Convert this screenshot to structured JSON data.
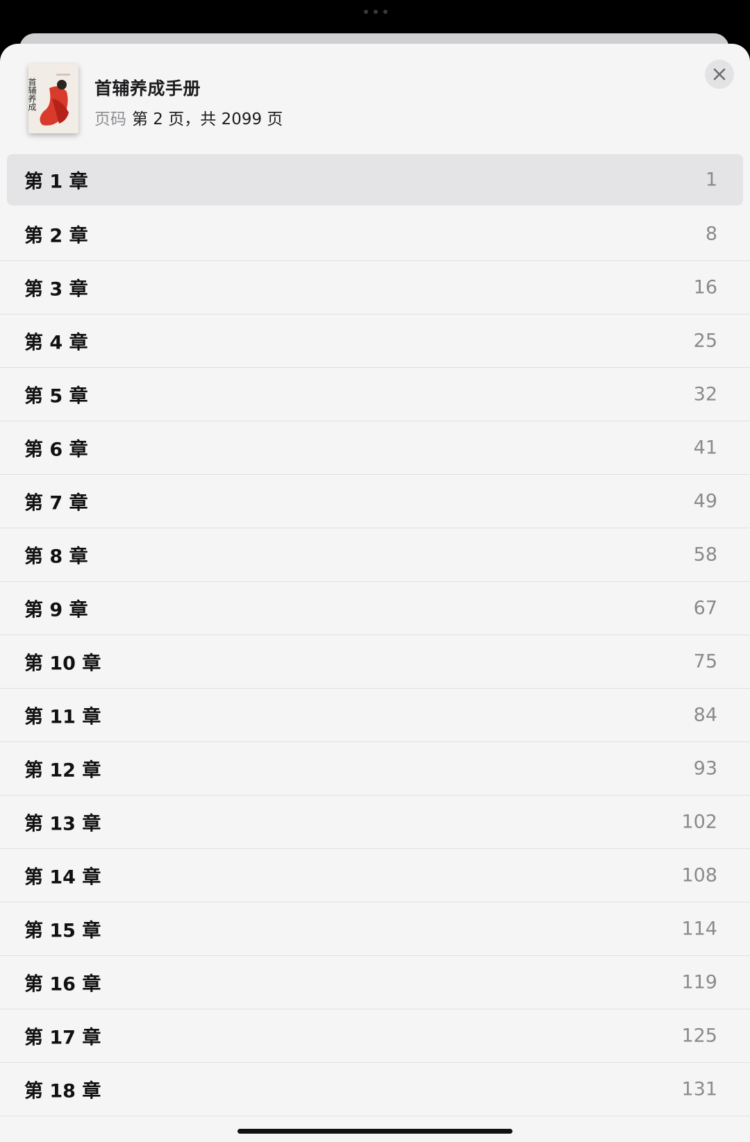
{
  "book": {
    "title": "首辅养成手册",
    "page_label": "页码",
    "page_value": "第 2 页，共 2099 页",
    "cover_text": "首辅养成"
  },
  "chapters": [
    {
      "title": "第 1 章",
      "page": "1",
      "current": true
    },
    {
      "title": "第 2 章",
      "page": "8"
    },
    {
      "title": "第 3 章",
      "page": "16"
    },
    {
      "title": "第 4 章",
      "page": "25"
    },
    {
      "title": "第 5 章",
      "page": "32"
    },
    {
      "title": "第 6 章",
      "page": "41"
    },
    {
      "title": "第 7 章",
      "page": "49"
    },
    {
      "title": "第 8 章",
      "page": "58"
    },
    {
      "title": "第 9 章",
      "page": "67"
    },
    {
      "title": "第 10 章",
      "page": "75"
    },
    {
      "title": "第 11 章",
      "page": "84"
    },
    {
      "title": "第 12 章",
      "page": "93"
    },
    {
      "title": "第 13 章",
      "page": "102"
    },
    {
      "title": "第 14 章",
      "page": "108"
    },
    {
      "title": "第 15 章",
      "page": "114"
    },
    {
      "title": "第 16 章",
      "page": "119"
    },
    {
      "title": "第 17 章",
      "page": "125"
    },
    {
      "title": "第 18 章",
      "page": "131"
    }
  ],
  "icons": {
    "close": "close-icon",
    "grabber": "grabber-dots-icon"
  },
  "colors": {
    "sheet": "#f5f5f5",
    "current_row": "#e4e4e6",
    "secondary_text": "#8a8a8e"
  }
}
